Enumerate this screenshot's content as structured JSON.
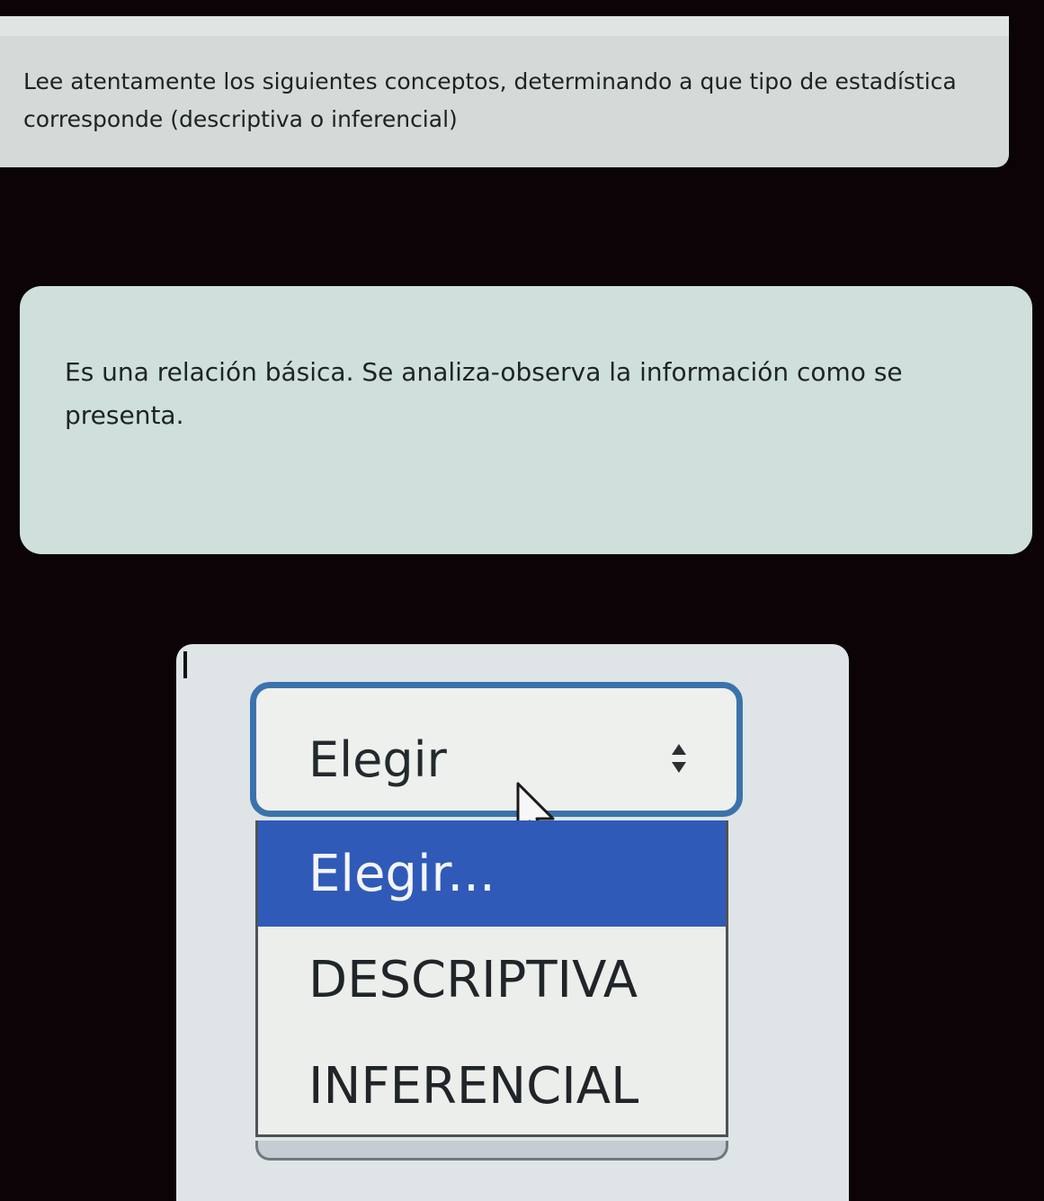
{
  "instruction": {
    "line1": "Lee atentamente los siguientes conceptos, determinando a que tipo de estadística",
    "line2": "corresponde (descriptiva o inferencial)"
  },
  "question": {
    "line1": "Es una relación básica. Se analiza-observa la información como se",
    "line2": "presenta."
  },
  "select": {
    "value": "Elegir",
    "options": [
      {
        "label": "Elegir...",
        "selected": true
      },
      {
        "label": "DESCRIPTIVA",
        "selected": false
      },
      {
        "label": "INFERENCIAL",
        "selected": false
      }
    ]
  },
  "colors": {
    "highlight": "#2f5ab8",
    "focus_border": "#3a73ab",
    "background": "#0b0306"
  },
  "icons": {
    "select_arrows": "updown-icon",
    "pointer": "cursor-icon"
  }
}
